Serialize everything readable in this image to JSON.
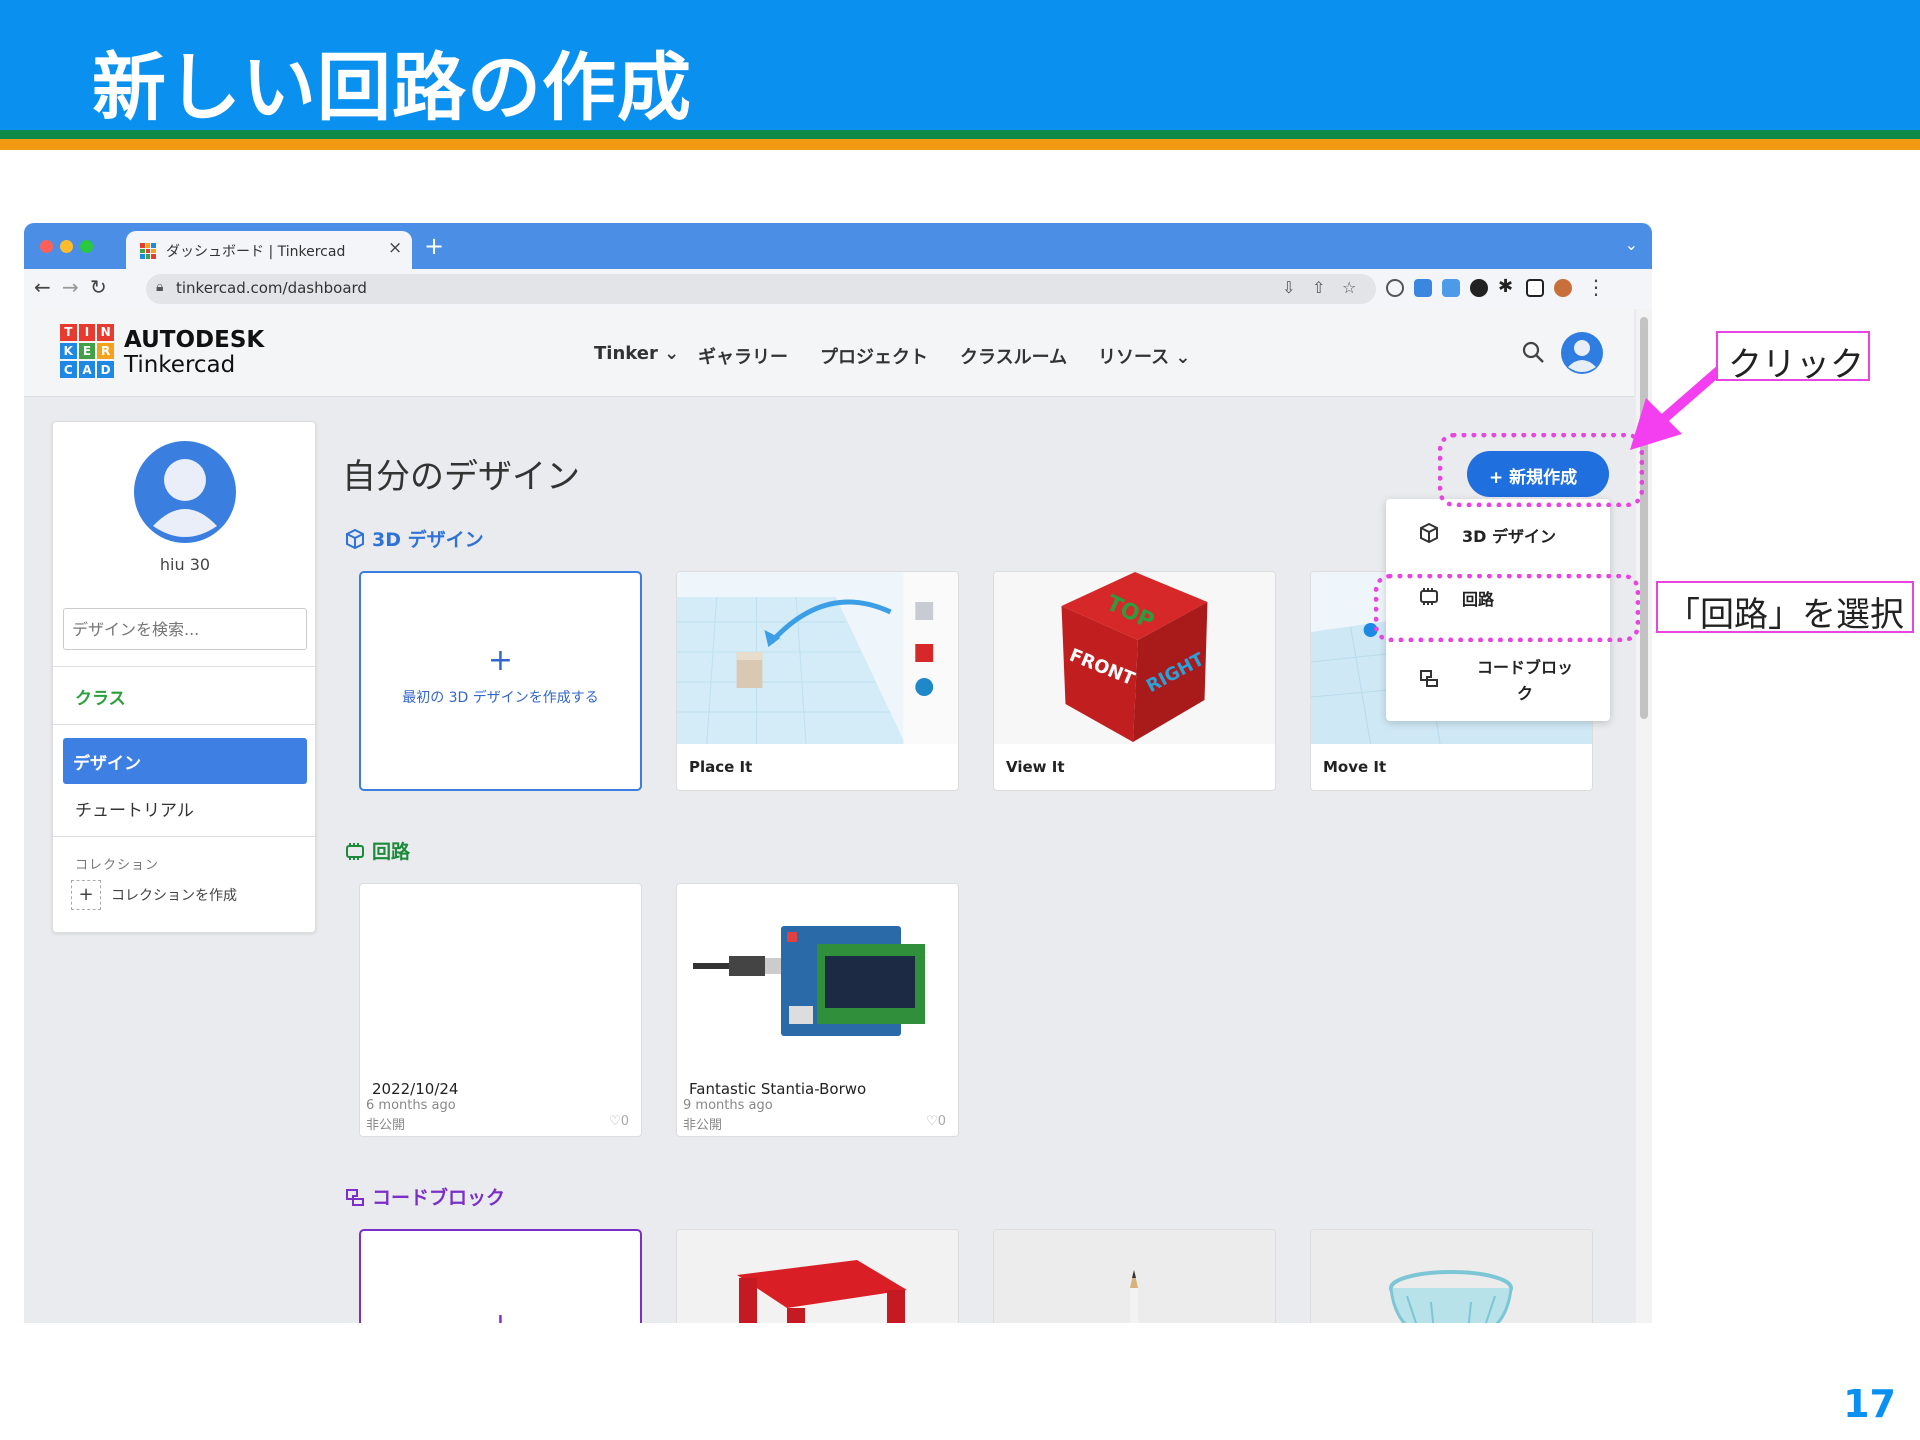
{
  "slide": {
    "title": "新しい回路の作成",
    "page_number": "17",
    "colors": {
      "header": "#0a91f0",
      "band_green": "#0d8a4a",
      "band_orange": "#f29a12",
      "annotation": "#e845e0"
    }
  },
  "browser": {
    "tab_title": "ダッシュボード | Tinkercad",
    "tab_close": "×",
    "new_tab": "+",
    "url": "tinkercad.com/dashboard"
  },
  "app": {
    "logo": {
      "letters": [
        "T",
        "I",
        "N",
        "K",
        "E",
        "R",
        "C",
        "A",
        "D"
      ],
      "autodesk": "AUTODESK",
      "tinkercad": "Tinkercad"
    },
    "menu": [
      "Tinker ⌄",
      "ギャラリー",
      "プロジェクト",
      "クラスルーム",
      "リソース ⌄"
    ],
    "sidebar": {
      "user_name": "hiu 30",
      "search_placeholder": "デザインを検索...",
      "class_label": "クラス",
      "design_label": "デザイン",
      "tutorial_label": "チュートリアル",
      "collection_heading": "コレクション",
      "create_collection_plus": "+",
      "create_collection_label": "コレクションを作成"
    },
    "main": {
      "title": "自分のデザイン",
      "new_button": "+ 新規作成",
      "sections": {
        "design3d": {
          "heading": "3D デザイン",
          "create_plus": "+",
          "create_label": "最初の 3D デザインを作成する",
          "cards": [
            "Place It",
            "View It",
            "Move It"
          ]
        },
        "circuits": {
          "heading": "回路",
          "cards": [
            {
              "title": "2022/10/24",
              "time": "6 months ago",
              "visibility": "非公開",
              "likes": "♡0"
            },
            {
              "title": "Fantastic Stantia-Borwo",
              "time": "9 months ago",
              "visibility": "非公開",
              "likes": "♡0"
            }
          ]
        },
        "codeblocks": {
          "heading": "コードブロック",
          "create_plus": "+"
        }
      },
      "dropdown": [
        "3D デザイン",
        "回路",
        "コードブロック"
      ]
    }
  },
  "annotations": {
    "click": "クリック",
    "select_circuit": "「回路」を選択"
  }
}
